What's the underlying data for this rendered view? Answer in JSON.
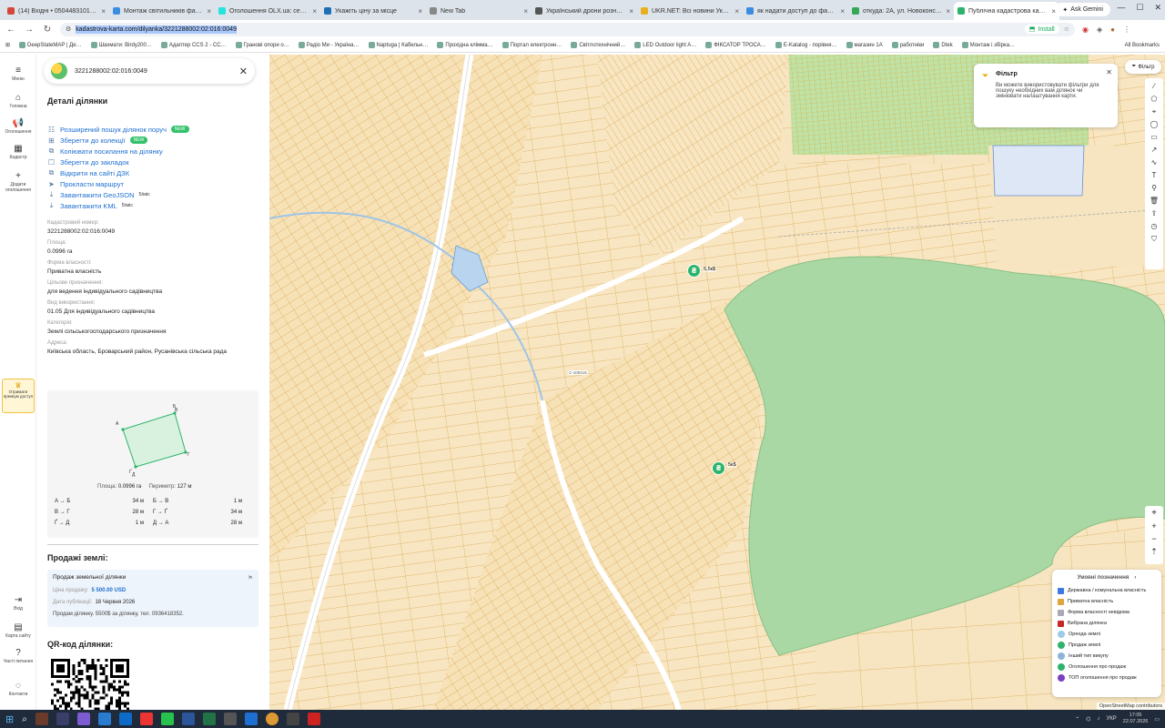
{
  "browser": {
    "tabs": [
      {
        "title": "(14) Вхідні • 0504483101@…",
        "color": "#d44638"
      },
      {
        "title": "Монтаж світильників фас…",
        "color": "#3b8de0"
      },
      {
        "title": "Оголошення OLX.ua: серв…",
        "color": "#23e5db"
      },
      {
        "title": "Укажіть ціну за місце",
        "color": "#1f6fb5"
      },
      {
        "title": "New Tab",
        "color": "#888888"
      },
      {
        "title": "Український дрони рознесь…",
        "color": "#555555"
      },
      {
        "title": "UKR.NET: Всі новини Укра…",
        "color": "#e8b020"
      },
      {
        "title": "як надати доступ до файл…",
        "color": "#3b8de0"
      },
      {
        "title": "откуда: 2А, ул. Новоконст…",
        "color": "#34a853"
      },
      {
        "title": "Публічна кадастрова карта…",
        "color": "#2db36b",
        "active": true
      }
    ],
    "new_tab_label": "+",
    "ask_gemini_label": "Ask Gemini",
    "url": "kadastrova-karta.com/dilyanka/3221288002:02:016:0049",
    "install_label": "Install",
    "bookmarks": [
      "DeepStateMAP | Де…",
      "Шахмати: Birdy200…",
      "Адаптер CCS 2 - CC…",
      "Гранові опори о…",
      "Радіо Ми - Україна…",
      "Naptuga | Кабельн…",
      "Прохідна клімма…",
      "Портал електронн…",
      "Світлотехнічний…",
      "LED Outdoor light A…",
      "ФІКСАТОР ТРОСА…",
      "E-Katalog - порівня…",
      "магазин 1А",
      "работніки",
      "Dtek",
      "Монтаж і збірка…"
    ],
    "all_bookmarks_label": "All Bookmarks"
  },
  "rail": {
    "menu": "Меню",
    "home": "Головна",
    "ads": "Оголошення",
    "cadastre": "Кадастр",
    "add_ad": "Додати оголошення",
    "premium": "Отримати преміум доступ",
    "login": "Вхід",
    "site_map": "Карта сайту",
    "faq": "Часті питання",
    "contacts": "Контакти"
  },
  "panel": {
    "search_value": "3221288002:02:016:0049",
    "title": "Деталі ділянки",
    "actions": [
      {
        "icon": "☷",
        "label": "Розширений пошук ділянок поруч",
        "badge": "NEW"
      },
      {
        "icon": "⊞",
        "label": "Зберегти до колекції",
        "badge": "NEW"
      },
      {
        "icon": "⧉",
        "label": "Копіювати посилання на ділянку"
      },
      {
        "icon": "☐",
        "label": "Зберегти до закладок"
      },
      {
        "icon": "⧉",
        "label": "Відкрити на сайті ДЗК"
      },
      {
        "icon": "➤",
        "label": "Прокласти маршрут"
      },
      {
        "icon": "⤓",
        "label": "Завантажити GeoJSON",
        "limit": "5/міс"
      },
      {
        "icon": "⤓",
        "label": "Завантажити KML",
        "limit": "5/міс"
      }
    ],
    "fields": [
      {
        "label": "Кадастровий номер:",
        "value": "3221288002:02:016:0049"
      },
      {
        "label": "Площа:",
        "value": "0.0996 га"
      },
      {
        "label": "Форма власності:",
        "value": "Приватна власність"
      },
      {
        "label": "Цільове призначення:",
        "value": "для ведення індивідуального садівництва"
      },
      {
        "label": "Вид використання:",
        "value": "01.05 Для індивідуального садівництва"
      },
      {
        "label": "Категорія:",
        "value": "Землі сільськогосподарського призначення"
      },
      {
        "label": "Адреса:",
        "value": "Київська область, Броварський район, Русанівська сільська рада"
      }
    ],
    "plot": {
      "vertices": [
        "А",
        "Б",
        "В",
        "Г",
        "Ґ",
        "Д"
      ],
      "area_label": "Площа:",
      "area_value": "0.0996 га",
      "perimeter_label": "Периметр:",
      "perimeter_value": "127 м",
      "measurements": [
        {
          "seg": "А → Б",
          "val": "34 м",
          "seg2": "Б → В",
          "val2": "1 м"
        },
        {
          "seg": "В → Г",
          "val": "28 м",
          "seg2": "Г → Ґ",
          "val2": "34 м"
        },
        {
          "seg": "Ґ → Д",
          "val": "1 м",
          "seg2": "Д → А",
          "val2": "28 м"
        }
      ]
    },
    "sale_heading": "Продажі землі:",
    "sale": {
      "title": "Продаж земельної ділянки",
      "price_label": "Ціна продажу:",
      "price_value": "5 500.00 USD",
      "date_label": "Дата публікації:",
      "date_value": "18 Червня 2026",
      "note": "Продам ділянку. 5500$ за ділянку, тел. 0936418352."
    },
    "qr_heading": "QR-код ділянки:"
  },
  "map": {
    "filter": {
      "title": "Фільтр",
      "text": "Ви можете використовувати фільтри для пошуку необхідних вам ділянок чи змінювати налаштування карти."
    },
    "filter_button": "Фільтр",
    "pins": [
      {
        "icon": "₴",
        "label": "5,5к$"
      },
      {
        "icon": "₴",
        "label": "5к$"
      }
    ],
    "road_labels": [
      "С-100415"
    ],
    "legend": {
      "title": "Умовні позначення",
      "items": [
        {
          "label": "Державна / комунальна власність",
          "color": "#3b7be0",
          "kind": "square"
        },
        {
          "label": "Приватна власність",
          "color": "#e0a63a",
          "kind": "square"
        },
        {
          "label": "Форма власності невідома",
          "color": "#a9a9b8",
          "kind": "square"
        },
        {
          "label": "Вибрана ділянка",
          "color": "#c62828",
          "kind": "square"
        },
        {
          "label": "Оренда землі",
          "color": "#9fc9e8",
          "kind": "round"
        },
        {
          "label": "Продаж землі",
          "color": "#2db36b",
          "kind": "round"
        },
        {
          "label": "Інший тип викупу",
          "color": "#8db4d8",
          "kind": "round"
        },
        {
          "label": "Оголошення про продаж",
          "color": "#2db36b",
          "kind": "round"
        },
        {
          "label": "ТОП оголошення про продаж",
          "color": "#7b3fc4",
          "kind": "round"
        }
      ]
    },
    "attribution": "OpenStreetMap contributors"
  },
  "taskbar": {
    "lang": "УКР",
    "time": "17:05",
    "date": "22.07.2026"
  }
}
